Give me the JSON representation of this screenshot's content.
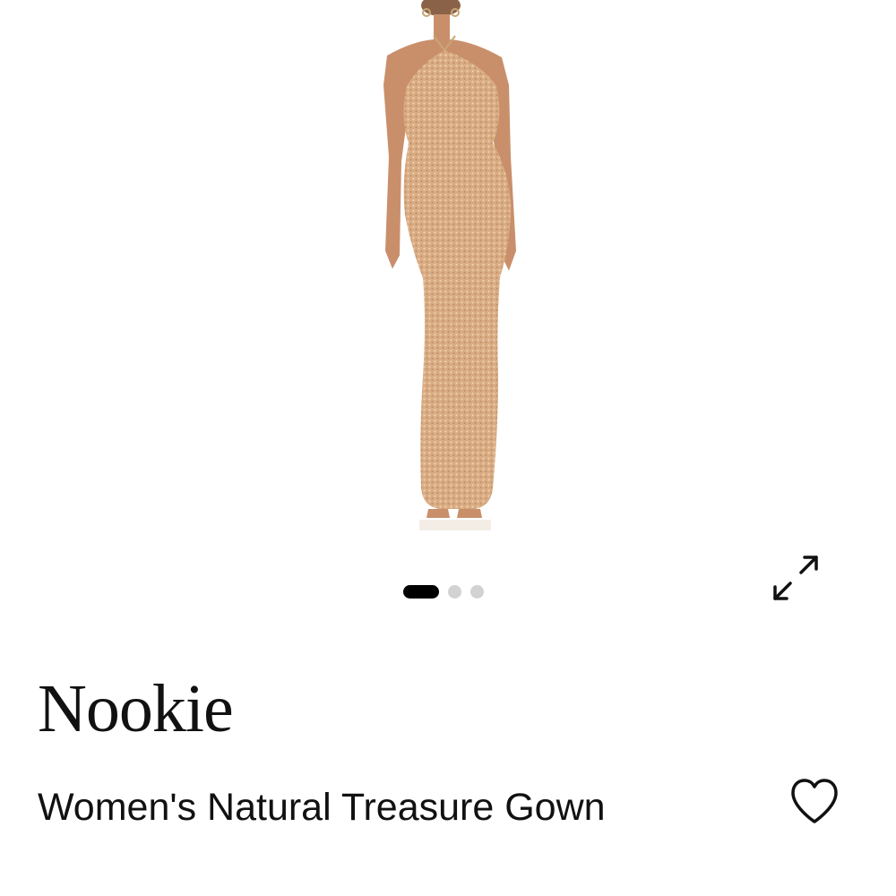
{
  "gallery": {
    "image_alt": "",
    "total_images": 3,
    "current_index": 1
  },
  "icons": {
    "expand": "expand-arrows-icon",
    "favorite": "heart-outline-icon"
  },
  "product": {
    "brand": "Nookie",
    "name": "Women's Natural Treasure Gown"
  },
  "colors": {
    "gown": "#d9ac84",
    "skin": "#c98f6b",
    "active_dot": "#000000",
    "inactive_dot": "#d2d2d2"
  }
}
